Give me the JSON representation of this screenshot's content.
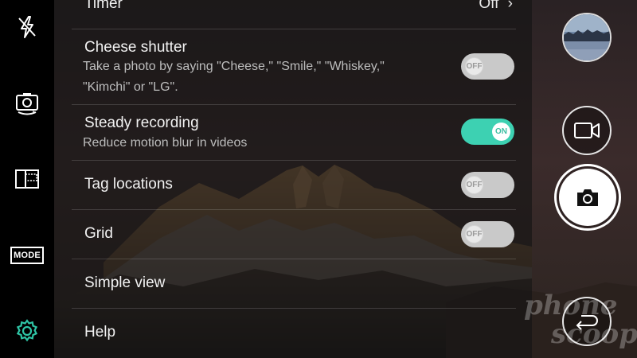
{
  "colors": {
    "accent": "#3dd1b2",
    "settings_icon": "#2ec4a5",
    "toggle_off": "#c9c9c9",
    "panel_overlay": "rgba(20,20,20,0.62)"
  },
  "left_rail": {
    "flash": {
      "icon": "flash-off-icon"
    },
    "switch_camera": {
      "icon": "switch-camera-icon"
    },
    "memory": {
      "icon": "sd-card-icon"
    },
    "mode": {
      "label": "MODE"
    },
    "settings": {
      "icon": "gear-icon"
    }
  },
  "settings": {
    "timer": {
      "title": "Timer",
      "value": "Off"
    },
    "cheese_shutter": {
      "title": "Cheese shutter",
      "description_line1": "Take a photo by saying \"Cheese,\" \"Smile,\" \"Whiskey,\"",
      "description_line2": "\"Kimchi\" or \"LG\".",
      "toggle_label": "OFF",
      "state": "off"
    },
    "steady_recording": {
      "title": "Steady recording",
      "description": "Reduce motion blur in videos",
      "toggle_label": "ON",
      "state": "on"
    },
    "tag_locations": {
      "title": "Tag locations",
      "toggle_label": "OFF",
      "state": "off"
    },
    "grid": {
      "title": "Grid",
      "toggle_label": "OFF",
      "state": "off"
    },
    "simple_view": {
      "title": "Simple view"
    },
    "help": {
      "title": "Help"
    }
  },
  "right_rail": {
    "gallery": {
      "icon": "gallery-thumbnail"
    },
    "video": {
      "icon": "video-camera-icon"
    },
    "shutter": {
      "icon": "camera-icon"
    },
    "back": {
      "icon": "back-arrow-icon"
    }
  },
  "watermark": {
    "line1": "phone",
    "line2": "scoop"
  }
}
